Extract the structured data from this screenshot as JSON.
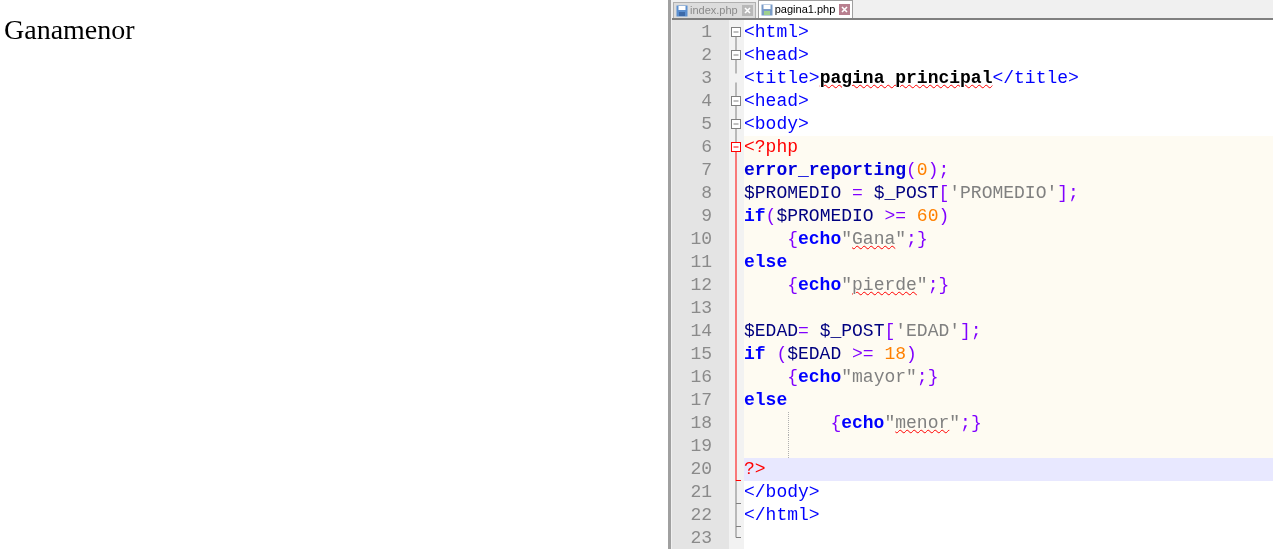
{
  "output_text": "Ganamenor",
  "tabs": [
    {
      "label": "index.php",
      "selected": false
    },
    {
      "label": "pagina1.php",
      "selected": true
    }
  ],
  "lines": [
    {
      "number": "1",
      "tokens": [
        {
          "kind": "tag",
          "text": "<html>"
        }
      ]
    },
    {
      "number": "2",
      "tokens": [
        {
          "kind": "tag",
          "text": "<head>"
        }
      ]
    },
    {
      "number": "3",
      "tokens": [
        {
          "kind": "tag",
          "text": "<title>"
        },
        {
          "kind": "bold",
          "text": "pagina principal",
          "spell": true
        },
        {
          "kind": "tag",
          "text": "</title>"
        }
      ]
    },
    {
      "number": "4",
      "tokens": [
        {
          "kind": "tag",
          "text": "<head>"
        }
      ]
    },
    {
      "number": "5",
      "tokens": [
        {
          "kind": "tag",
          "text": "<body>"
        }
      ]
    },
    {
      "number": "6",
      "php": true,
      "tokens": [
        {
          "kind": "delim",
          "text": "<?php"
        }
      ]
    },
    {
      "number": "7",
      "php": true,
      "tokens": [
        {
          "kind": "func",
          "text": "error_reporting"
        },
        {
          "kind": "op",
          "text": "("
        },
        {
          "kind": "number",
          "text": "0"
        },
        {
          "kind": "op",
          "text": ");"
        }
      ]
    },
    {
      "number": "8",
      "php": true,
      "tokens": [
        {
          "kind": "var",
          "text": "$PROMEDIO"
        },
        {
          "kind": "op",
          "text": " = "
        },
        {
          "kind": "var",
          "text": "$_POST"
        },
        {
          "kind": "op",
          "text": "["
        },
        {
          "kind": "string",
          "text": "'PROMEDIO'"
        },
        {
          "kind": "op",
          "text": "];"
        }
      ]
    },
    {
      "number": "9",
      "php": true,
      "tokens": [
        {
          "kind": "keyword",
          "text": "if"
        },
        {
          "kind": "op",
          "text": "("
        },
        {
          "kind": "var",
          "text": "$PROMEDIO"
        },
        {
          "kind": "op",
          "text": " >= "
        },
        {
          "kind": "number",
          "text": "60"
        },
        {
          "kind": "op",
          "text": ")"
        }
      ]
    },
    {
      "number": "10",
      "php": true,
      "tokens": [
        {
          "kind": "op",
          "text": "    {"
        },
        {
          "kind": "keyword",
          "text": "echo"
        },
        {
          "kind": "string",
          "text": "\""
        },
        {
          "kind": "string",
          "text": "Gana",
          "spell": true
        },
        {
          "kind": "string",
          "text": "\""
        },
        {
          "kind": "op",
          "text": ";}"
        }
      ]
    },
    {
      "number": "11",
      "php": true,
      "tokens": [
        {
          "kind": "keyword",
          "text": "else"
        }
      ]
    },
    {
      "number": "12",
      "php": true,
      "tokens": [
        {
          "kind": "op",
          "text": "    {"
        },
        {
          "kind": "keyword",
          "text": "echo"
        },
        {
          "kind": "string",
          "text": "\""
        },
        {
          "kind": "string",
          "text": "pierde",
          "spell": true
        },
        {
          "kind": "string",
          "text": "\""
        },
        {
          "kind": "op",
          "text": ";}"
        }
      ]
    },
    {
      "number": "13",
      "php": true
    },
    {
      "number": "14",
      "php": true,
      "tokens": [
        {
          "kind": "var",
          "text": "$EDAD"
        },
        {
          "kind": "op",
          "text": "= "
        },
        {
          "kind": "var",
          "text": "$_POST"
        },
        {
          "kind": "op",
          "text": "["
        },
        {
          "kind": "string",
          "text": "'EDAD'"
        },
        {
          "kind": "op",
          "text": "];"
        }
      ]
    },
    {
      "number": "15",
      "php": true,
      "tokens": [
        {
          "kind": "keyword",
          "text": "if"
        },
        {
          "kind": "op",
          "text": " ("
        },
        {
          "kind": "var",
          "text": "$EDAD"
        },
        {
          "kind": "op",
          "text": " >= "
        },
        {
          "kind": "number",
          "text": "18"
        },
        {
          "kind": "op",
          "text": ")"
        }
      ]
    },
    {
      "number": "16",
      "php": true,
      "tokens": [
        {
          "kind": "op",
          "text": "    {"
        },
        {
          "kind": "keyword",
          "text": "echo"
        },
        {
          "kind": "string",
          "text": "\"mayor\""
        },
        {
          "kind": "op",
          "text": ";}"
        }
      ]
    },
    {
      "number": "17",
      "php": true,
      "tokens": [
        {
          "kind": "keyword",
          "text": "else"
        }
      ]
    },
    {
      "number": "18",
      "php": true,
      "guide": true,
      "tokens": [
        {
          "kind": "op",
          "text": "        {"
        },
        {
          "kind": "keyword",
          "text": "echo"
        },
        {
          "kind": "string",
          "text": "\""
        },
        {
          "kind": "string",
          "text": "menor",
          "spell": true
        },
        {
          "kind": "string",
          "text": "\""
        },
        {
          "kind": "op",
          "text": ";}"
        }
      ]
    },
    {
      "number": "19",
      "php": true,
      "guide": true
    },
    {
      "number": "20",
      "current": true,
      "tokens": [
        {
          "kind": "delim",
          "text": "?>"
        }
      ]
    },
    {
      "number": "21",
      "tokens": [
        {
          "kind": "tag",
          "text": "</body>"
        }
      ]
    },
    {
      "number": "22",
      "tokens": [
        {
          "kind": "tag",
          "text": "</html>"
        }
      ]
    },
    {
      "number": "23"
    }
  ]
}
